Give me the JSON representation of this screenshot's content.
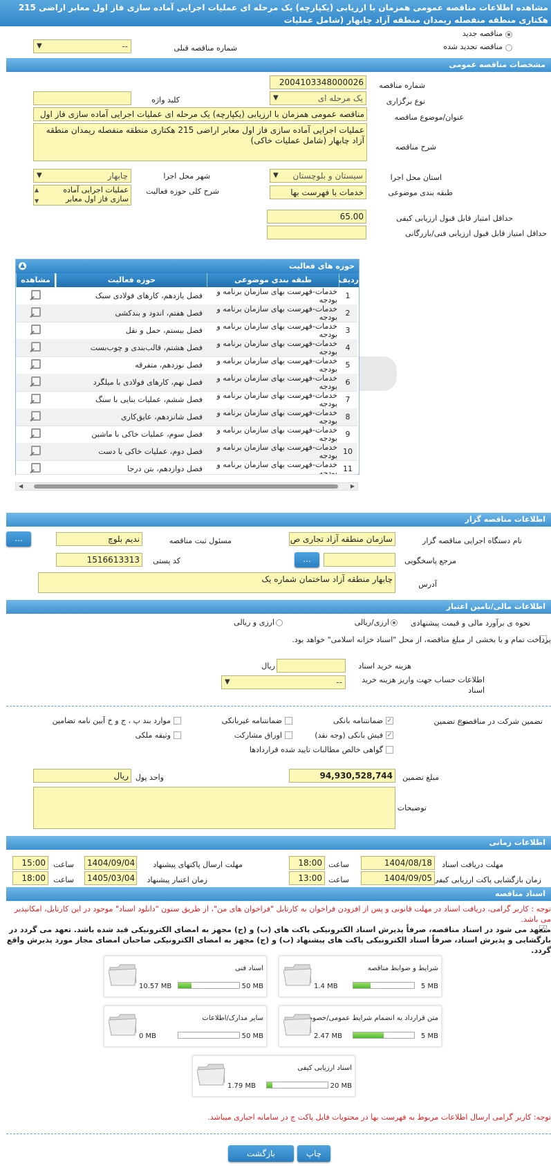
{
  "title": "مشاهده اطلاعات مناقصه عمومی همزمان با ارزیابی (یکپارچه) یک مرحله ای عملیات اجرایی آماده سازی فاز اول معابر اراضی 215 هکتاری منطقه منفصله ریمدان منطقه آزاد چابهار (شامل عملیات",
  "tender_type": {
    "new": "مناقصه جدید",
    "renewed": "مناقصه تجدید شده",
    "prev_label": "شماره مناقصه قبلی",
    "prev_value": "--"
  },
  "general": {
    "header": "مشخصات مناقصه عمومی",
    "number_label": "شماره مناقصه",
    "number": "2004103348000026",
    "holding_label": "نوع برگزاری",
    "holding": "یک مرحله ای",
    "keyword_label": "کلید واژه",
    "keyword": "",
    "subject_label": "عنوان/موضوع مناقصه",
    "subject": "مناقصه عمومی همزمان با ارزیابی (یکپارچه) یک مرحله ای عملیات اجرایی آماده سازی فاز اول",
    "desc_label": "شرح مناقصه",
    "desc": "عملیات اجرایی آماده سازی فاز اول معابر اراضی 215 هکتاری منطقه منفصله ریمدان منطقه آزاد چابهار (شامل عملیات خاکی)",
    "province_label": "استان محل اجرا",
    "province": "سیستان و بلوچستان",
    "city_label": "شهر محل اجرا",
    "city": "چابهار",
    "category_label": "طبقه بندی موضوعی",
    "category": "خدمات با فهرست بها",
    "scope_label": "شرح کلی حوزه فعالیت",
    "scope": "عملیات اجرایی آماده سازی فاز اول معابر اراضی",
    "min_quality_label": "حداقل امتیاز قابل قبول ارزیابی کیفی",
    "min_quality": "65.00",
    "min_tech_label": "حداقل امتیاز قابل قبول ارزیابی فنی/بازرگانی",
    "min_tech": ""
  },
  "activities": {
    "header": "حوزه های فعالیت",
    "columns": [
      "ردیف",
      "طبقه بندی موضوعی",
      "حوزه فعالیت",
      "مشاهده"
    ],
    "rows": [
      {
        "n": "1",
        "cat": "خدمات-فهرست بهای سازمان برنامه و بودجه",
        "act": "فصل یازدهم، کارهای فولادی سبک"
      },
      {
        "n": "2",
        "cat": "خدمات-فهرست بهای سازمان برنامه و بودجه",
        "act": "فصل هفتم، اندود و بندکشی"
      },
      {
        "n": "3",
        "cat": "خدمات-فهرست بهای سازمان برنامه و بودجه",
        "act": "فصل بیستم، حمل و نقل"
      },
      {
        "n": "4",
        "cat": "خدمات-فهرست بهای سازمان برنامه و بودجه",
        "act": "فصل هشتم، قالب‌بندی و چوب‌بست"
      },
      {
        "n": "5",
        "cat": "خدمات-فهرست بهای سازمان برنامه و بودجه",
        "act": "فصل نوزدهم، متفرقه"
      },
      {
        "n": "6",
        "cat": "خدمات-فهرست بهای سازمان برنامه و بودجه",
        "act": "فصل نهم، کارهای فولادی با میلگرد"
      },
      {
        "n": "7",
        "cat": "خدمات-فهرست بهای سازمان برنامه و بودجه",
        "act": "فصل ششم، عملیات بنایی با سنگ"
      },
      {
        "n": "8",
        "cat": "خدمات-فهرست بهای سازمان برنامه و بودجه",
        "act": "فصل شانزدهم، عایق‌کاری"
      },
      {
        "n": "9",
        "cat": "خدمات-فهرست بهای سازمان برنامه و بودجه",
        "act": "فصل سوم، عملیات خاکی با ماشین"
      },
      {
        "n": "10",
        "cat": "خدمات-فهرست بهای سازمان برنامه و بودجه",
        "act": "فصل دوم، عملیات خاکی با دست"
      },
      {
        "n": "11",
        "cat": "خدمات-فهرست بهای سازمان برنامه و بودجه",
        "act": "فصل دوازدهم، بتن درجا"
      }
    ]
  },
  "organizer": {
    "header": "اطلاعات مناقصه گزار",
    "org_label": "نام دستگاه اجرایی مناقصه گزار",
    "org": "سازمان منطقه آزاد تجاری ص",
    "officer_label": "مسئول ثبت مناقصه",
    "officer": "ندیم بلوچ",
    "ref_label": "مرجع پاسخگویی",
    "ref": "",
    "postal_label": "کد پستی",
    "postal": "1516613313",
    "address_label": "آدرس",
    "address": "چابهار منطقه آزاد  ساختمان شماره یک",
    "dots": "..."
  },
  "finance": {
    "header": "اطلاعات مالی/تامین اعتبار",
    "estimate_label": "نحوه ی برآورد مالی و قیمت پیشنهادی",
    "opt_rial": "ارزی/ریالی",
    "opt_currency": "ارزی و ریالی",
    "treasury_text": "پرداخت تمام و یا بخشی از مبلغ مناقصه، از محل \"اسناد خزانه اسلامی\" خواهد بود.",
    "doc_cost_label": "هزینه خرید اسناد",
    "doc_cost": "",
    "doc_cost_unit": "ریال",
    "account_label": "اطلاعات حساب جهت واریز هزینه خرید اسناد",
    "account": "--"
  },
  "guarantee": {
    "label": "تضمین شرکت در مناقصه:",
    "type_label": "نوع تضمین",
    "options": [
      "ضمانتنامه بانکی",
      "ضمانتنامه غیربانکی",
      "موارد بند پ ، ج و خ آیین نامه تضامین",
      "فیش بانکی (وجه نقد)",
      "اوراق مشارکت",
      "وثیقه ملکی",
      "گواهی خالص مطالبات تایید شده قراردادها"
    ],
    "amount_label": "مبلغ تضمین",
    "amount": "94,930,528,744",
    "currency_label": "واحد پول",
    "currency": "ریال",
    "notes_label": "توضیحات",
    "notes": ""
  },
  "timing": {
    "header": "اطلاعات زمانی",
    "receive_label": "مهلت دریافت اسناد",
    "receive_date": "1404/08/18",
    "receive_time": "18:00",
    "send_label": "مهلت ارسال پاکتهای پیشنهاد",
    "send_date": "1404/09/04",
    "send_time": "15:00",
    "open_label": "زمان بازگشایی پاکت ارزیابی کیفی",
    "open_date": "1404/09/05",
    "open_time": "13:00",
    "valid_label": "زمان اعتبار پیشنهاد",
    "valid_date": "1405/03/04",
    "valid_time": "18:00",
    "time_label": "ساعت"
  },
  "documents": {
    "header": "اسناد مناقصه",
    "notice1": "توجه : کاربر گرامی، دریافت اسناد در مهلت قانونی و پس از افزودن فراخوان به کارتابل \"فراخوان های من\"، از طریق ستون \"دانلود اسناد\" موجود در این کارتابل، امکانپذیر می باشد.",
    "pledge": "متعهد می شود در اسناد مناقصه، صرفاً پذیرش اسناد الکترونیکی پاکت های (ب) و (ج) مجهز به امضای الکترونیکی قید شده باشد. تعهد می گردد در بارگشایی و پذیرش اسناد، صرفاً اسناد الکترونیکی پاکت های پیشنهاد (ب) و (ج) مجهز به امضای الکترونیکی صاحبان امضای مجاز مورد پذیرش واقع گردد.",
    "files": [
      {
        "name": "شرایط و ضوابط مناقصه",
        "max": "5 MB",
        "cur": "1.4 MB",
        "fill": 0.28
      },
      {
        "name": "اسناد فنی",
        "max": "50 MB",
        "cur": "10.57 MB",
        "fill": 0.22
      },
      {
        "name": "متن قرارداد به انضمام شرایط عمومی/خصوصی",
        "max": "5 MB",
        "cur": "2.47 MB",
        "fill": 0.5
      },
      {
        "name": "سایر مدارک/اطلاعات",
        "max": "50 MB",
        "cur": "0 MB",
        "fill": 0.0
      },
      {
        "name": "اسناد ارزیابی کیفی",
        "max": "20 MB",
        "cur": "1.79 MB",
        "fill": 0.09
      }
    ],
    "notice2": "توجه: کاربر گرامی ارسال اطلاعات مربوط به فهرست بها در محتویات فایل پاکت ج در سامانه اجباری میباشد."
  },
  "buttons": {
    "back": "بازگشت",
    "print": "چاپ"
  },
  "colors": {
    "header_blue": "#3f92d0",
    "field_yellow": "#fbf7b4",
    "notice_red": "#e02020"
  }
}
